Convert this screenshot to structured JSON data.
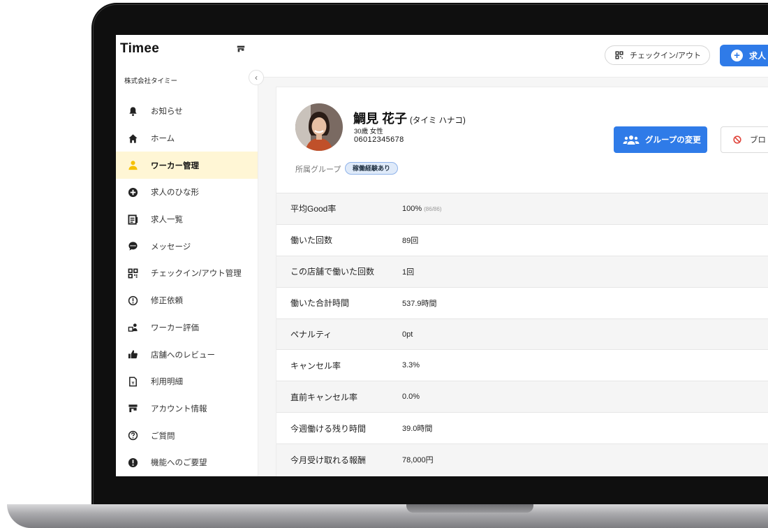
{
  "sidebar": {
    "logo": "Timee",
    "company": "株式会社タイミー",
    "items": [
      {
        "label": "お知らせ",
        "icon": "bell-icon"
      },
      {
        "label": "ホーム",
        "icon": "home-icon"
      },
      {
        "label": "ワーカー管理",
        "icon": "person-icon",
        "active": true
      },
      {
        "label": "求人のひな形",
        "icon": "plus-circle-icon"
      },
      {
        "label": "求人一覧",
        "icon": "list-icon"
      },
      {
        "label": "メッセージ",
        "icon": "chat-icon"
      },
      {
        "label": "チェックイン/アウト管理",
        "icon": "qr-icon"
      },
      {
        "label": "修正依頼",
        "icon": "exclamation-circle-icon"
      },
      {
        "label": "ワーカー評価",
        "icon": "rating-icon"
      },
      {
        "label": "店舗へのレビュー",
        "icon": "thumbs-up-icon"
      },
      {
        "label": "利用明細",
        "icon": "invoice-icon"
      },
      {
        "label": "アカウント情報",
        "icon": "store-icon"
      },
      {
        "label": "ご質問",
        "icon": "question-circle-icon"
      },
      {
        "label": "機能へのご要望",
        "icon": "alert-circle-icon"
      }
    ]
  },
  "header": {
    "checkin_label": "チェックイン/アウト",
    "create_label": "求人"
  },
  "worker": {
    "name": "鯛見 花子",
    "kana": "(タイミ ハナコ)",
    "age_gender": "30歳 女性",
    "phone": "06012345678",
    "group_label": "所属グループ",
    "group_badge": "稼働経験あり",
    "change_group_label": "グループの変更",
    "block_label": "ブロ"
  },
  "stats": [
    {
      "label": "平均Good率",
      "value": "100%",
      "sub": "(86/86)"
    },
    {
      "label": "働いた回数",
      "value": "89回",
      "sub": ""
    },
    {
      "label": "この店舗で働いた回数",
      "value": "1回",
      "sub": ""
    },
    {
      "label": "働いた合計時間",
      "value": "537.9時間",
      "sub": ""
    },
    {
      "label": "ペナルティ",
      "value": "0pt",
      "sub": ""
    },
    {
      "label": "キャンセル率",
      "value": "3.3%",
      "sub": ""
    },
    {
      "label": "直前キャンセル率",
      "value": "0.0%",
      "sub": ""
    },
    {
      "label": "今週働ける残り時間",
      "value": "39.0時間",
      "sub": ""
    },
    {
      "label": "今月受け取れる報酬",
      "value": "78,000円",
      "sub": ""
    }
  ],
  "colors": {
    "accent": "#2f7be8",
    "active_bg": "#fff6d5",
    "active_icon": "#f5c000"
  }
}
